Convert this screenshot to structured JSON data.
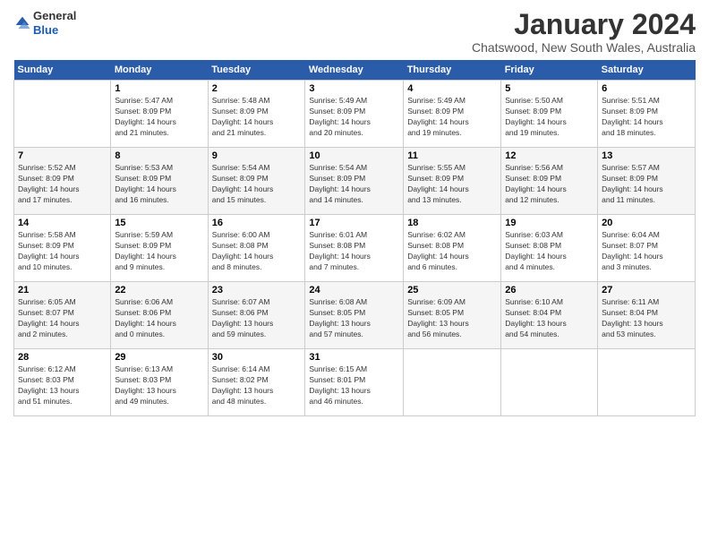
{
  "header": {
    "logo_line1": "General",
    "logo_line2": "Blue",
    "title": "January 2024",
    "subtitle": "Chatswood, New South Wales, Australia"
  },
  "calendar": {
    "days_of_week": [
      "Sunday",
      "Monday",
      "Tuesday",
      "Wednesday",
      "Thursday",
      "Friday",
      "Saturday"
    ],
    "weeks": [
      [
        {
          "num": "",
          "info": ""
        },
        {
          "num": "1",
          "info": "Sunrise: 5:47 AM\nSunset: 8:09 PM\nDaylight: 14 hours\nand 21 minutes."
        },
        {
          "num": "2",
          "info": "Sunrise: 5:48 AM\nSunset: 8:09 PM\nDaylight: 14 hours\nand 21 minutes."
        },
        {
          "num": "3",
          "info": "Sunrise: 5:49 AM\nSunset: 8:09 PM\nDaylight: 14 hours\nand 20 minutes."
        },
        {
          "num": "4",
          "info": "Sunrise: 5:49 AM\nSunset: 8:09 PM\nDaylight: 14 hours\nand 19 minutes."
        },
        {
          "num": "5",
          "info": "Sunrise: 5:50 AM\nSunset: 8:09 PM\nDaylight: 14 hours\nand 19 minutes."
        },
        {
          "num": "6",
          "info": "Sunrise: 5:51 AM\nSunset: 8:09 PM\nDaylight: 14 hours\nand 18 minutes."
        }
      ],
      [
        {
          "num": "7",
          "info": "Sunrise: 5:52 AM\nSunset: 8:09 PM\nDaylight: 14 hours\nand 17 minutes."
        },
        {
          "num": "8",
          "info": "Sunrise: 5:53 AM\nSunset: 8:09 PM\nDaylight: 14 hours\nand 16 minutes."
        },
        {
          "num": "9",
          "info": "Sunrise: 5:54 AM\nSunset: 8:09 PM\nDaylight: 14 hours\nand 15 minutes."
        },
        {
          "num": "10",
          "info": "Sunrise: 5:54 AM\nSunset: 8:09 PM\nDaylight: 14 hours\nand 14 minutes."
        },
        {
          "num": "11",
          "info": "Sunrise: 5:55 AM\nSunset: 8:09 PM\nDaylight: 14 hours\nand 13 minutes."
        },
        {
          "num": "12",
          "info": "Sunrise: 5:56 AM\nSunset: 8:09 PM\nDaylight: 14 hours\nand 12 minutes."
        },
        {
          "num": "13",
          "info": "Sunrise: 5:57 AM\nSunset: 8:09 PM\nDaylight: 14 hours\nand 11 minutes."
        }
      ],
      [
        {
          "num": "14",
          "info": "Sunrise: 5:58 AM\nSunset: 8:09 PM\nDaylight: 14 hours\nand 10 minutes."
        },
        {
          "num": "15",
          "info": "Sunrise: 5:59 AM\nSunset: 8:09 PM\nDaylight: 14 hours\nand 9 minutes."
        },
        {
          "num": "16",
          "info": "Sunrise: 6:00 AM\nSunset: 8:08 PM\nDaylight: 14 hours\nand 8 minutes."
        },
        {
          "num": "17",
          "info": "Sunrise: 6:01 AM\nSunset: 8:08 PM\nDaylight: 14 hours\nand 7 minutes."
        },
        {
          "num": "18",
          "info": "Sunrise: 6:02 AM\nSunset: 8:08 PM\nDaylight: 14 hours\nand 6 minutes."
        },
        {
          "num": "19",
          "info": "Sunrise: 6:03 AM\nSunset: 8:08 PM\nDaylight: 14 hours\nand 4 minutes."
        },
        {
          "num": "20",
          "info": "Sunrise: 6:04 AM\nSunset: 8:07 PM\nDaylight: 14 hours\nand 3 minutes."
        }
      ],
      [
        {
          "num": "21",
          "info": "Sunrise: 6:05 AM\nSunset: 8:07 PM\nDaylight: 14 hours\nand 2 minutes."
        },
        {
          "num": "22",
          "info": "Sunrise: 6:06 AM\nSunset: 8:06 PM\nDaylight: 14 hours\nand 0 minutes."
        },
        {
          "num": "23",
          "info": "Sunrise: 6:07 AM\nSunset: 8:06 PM\nDaylight: 13 hours\nand 59 minutes."
        },
        {
          "num": "24",
          "info": "Sunrise: 6:08 AM\nSunset: 8:05 PM\nDaylight: 13 hours\nand 57 minutes."
        },
        {
          "num": "25",
          "info": "Sunrise: 6:09 AM\nSunset: 8:05 PM\nDaylight: 13 hours\nand 56 minutes."
        },
        {
          "num": "26",
          "info": "Sunrise: 6:10 AM\nSunset: 8:04 PM\nDaylight: 13 hours\nand 54 minutes."
        },
        {
          "num": "27",
          "info": "Sunrise: 6:11 AM\nSunset: 8:04 PM\nDaylight: 13 hours\nand 53 minutes."
        }
      ],
      [
        {
          "num": "28",
          "info": "Sunrise: 6:12 AM\nSunset: 8:03 PM\nDaylight: 13 hours\nand 51 minutes."
        },
        {
          "num": "29",
          "info": "Sunrise: 6:13 AM\nSunset: 8:03 PM\nDaylight: 13 hours\nand 49 minutes."
        },
        {
          "num": "30",
          "info": "Sunrise: 6:14 AM\nSunset: 8:02 PM\nDaylight: 13 hours\nand 48 minutes."
        },
        {
          "num": "31",
          "info": "Sunrise: 6:15 AM\nSunset: 8:01 PM\nDaylight: 13 hours\nand 46 minutes."
        },
        {
          "num": "",
          "info": ""
        },
        {
          "num": "",
          "info": ""
        },
        {
          "num": "",
          "info": ""
        }
      ]
    ]
  }
}
